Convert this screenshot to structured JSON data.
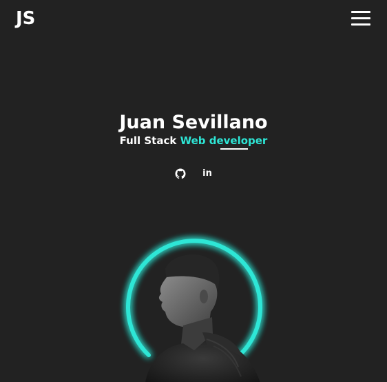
{
  "header": {
    "logo": "JS",
    "menu_icon": "hamburger-menu-icon"
  },
  "hero": {
    "name": "Juan Sevillano",
    "role_prefix": "Full Stack",
    "role_accent": "Web developer"
  },
  "socials": [
    {
      "icon": "github-icon"
    },
    {
      "icon": "linkedin-icon",
      "glyph": "in"
    }
  ],
  "colors": {
    "background": "#222222",
    "accent": "#2ee6d6",
    "text": "#ffffff"
  }
}
